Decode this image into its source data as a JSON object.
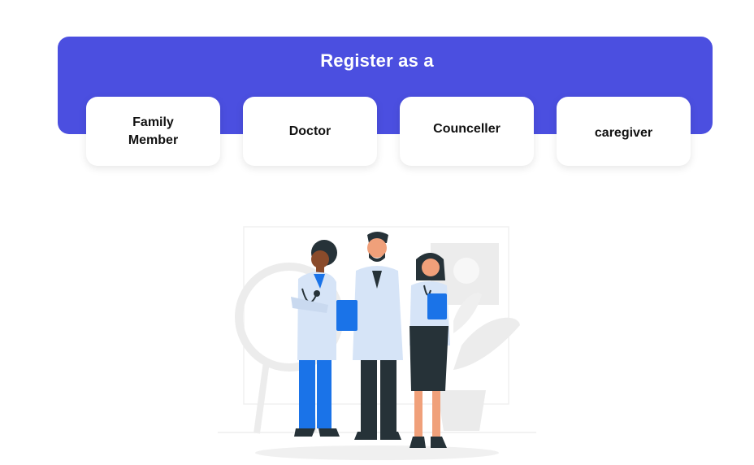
{
  "header": {
    "title": "Register as a"
  },
  "roles": [
    {
      "label": "Family\nMember"
    },
    {
      "label": "Doctor"
    },
    {
      "label": "Counceller"
    },
    {
      "label": "caregiver"
    }
  ],
  "colors": {
    "accent": "#4b4fe0",
    "card_bg": "#ffffff",
    "coat": "#d6e4f7",
    "blue": "#1a73e8",
    "dark": "#1f2a33"
  },
  "illustration": {
    "icon": "medical-team-illustration"
  }
}
